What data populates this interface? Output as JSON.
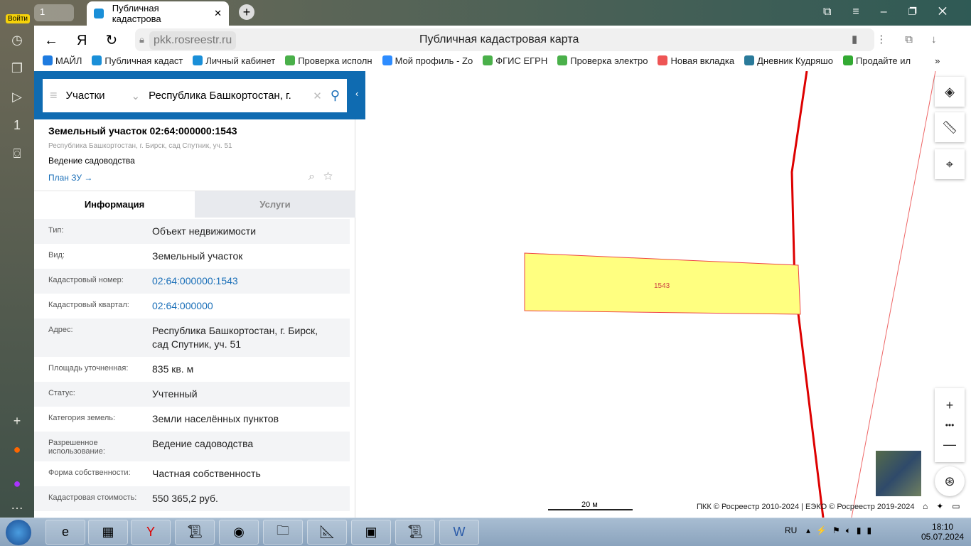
{
  "browser": {
    "login": "Войти",
    "tab_count": "1",
    "tab_title": "Публичная кадастрова",
    "url": "pkk.rosreestr.ru",
    "page_title": "Публичная кадастровая карта",
    "bookmarks": [
      "МАЙЛ",
      "Публичная кадаст",
      "Личный кабинет",
      "Проверка исполн",
      "Мой профиль - Zo",
      "ФГИС ЕГРН",
      "Проверка электро",
      "Новая вкладка",
      "Дневник Кудряшо",
      "Продайте ил"
    ],
    "more": "»"
  },
  "search": {
    "category": "Участки",
    "query": "Республика Башкортостан, г."
  },
  "object": {
    "title": "Земельный участок 02:64:000000:1543",
    "address": "Республика Башкортостан, г. Бирск, сад Спутник, уч. 51",
    "use": "Ведение садоводства",
    "plan_link": "План ЗУ →"
  },
  "tabs": [
    "Информация",
    "Услуги"
  ],
  "info": [
    {
      "label": "Тип:",
      "value": "Объект недвижимости"
    },
    {
      "label": "Вид:",
      "value": "Земельный участок"
    },
    {
      "label": "Кадастровый номер:",
      "value": "02:64:000000:1543",
      "link": true
    },
    {
      "label": "Кадастровый квартал:",
      "value": "02:64:000000",
      "link": true
    },
    {
      "label": "Адрес:",
      "value": "Республика Башкортостан, г. Бирск, сад Спутник, уч. 51"
    },
    {
      "label": "Площадь уточненная:",
      "value": "835 кв. м"
    },
    {
      "label": "Статус:",
      "value": "Учтенный"
    },
    {
      "label": "Категория земель:",
      "value": "Земли населённых пунктов"
    },
    {
      "label": "Разрешенное использование:",
      "value": "Ведение садоводства"
    },
    {
      "label": "Форма собственности:",
      "value": "Частная собственность"
    },
    {
      "label": "Кадастровая стоимость:",
      "value": "550 365,2 руб."
    }
  ],
  "map": {
    "parcel_label": "1543",
    "scale": "20 м",
    "copyright": "ПКК © Росреестр 2010-2024 | ЕЭКО © Росреестр 2019-2024"
  },
  "tray": {
    "lang": "RU",
    "time": "18:10",
    "date": "05.07.2024"
  }
}
